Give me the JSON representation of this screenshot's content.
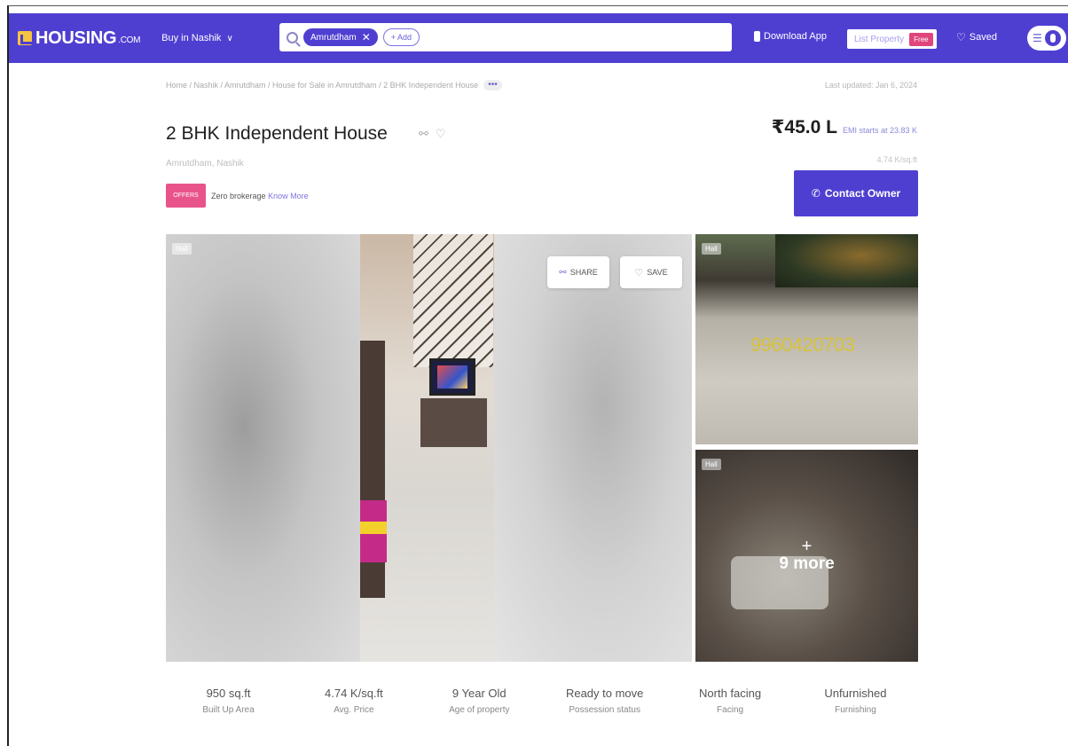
{
  "header": {
    "logo_text": "HOUSING",
    "logo_suffix": ".COM",
    "city_label": "Buy in Nashik",
    "search_chip": "Amrutdham",
    "add_label": "+ Add",
    "download_app": "Download App",
    "list_property": "List Property",
    "free_badge": "Free",
    "saved": "Saved",
    "brand_color": "#4f3fd1"
  },
  "breadcrumb": {
    "path": "Home / Nashik / Amrutdham / House for Sale in Amrutdham / 2 BHK Independent House",
    "more": "•••"
  },
  "last_updated": "Last updated: Jan 6, 2024",
  "listing": {
    "title": "2 BHK Independent House",
    "location": "Amrutdham, Nashik",
    "offers_badge": "OFFERS",
    "offers_text": "Zero brokerage",
    "offers_link": "Know More",
    "price": "₹45.0 L",
    "emi": "EMI starts at 23.83 K",
    "price_per_sqft": "4.74 K/sq.ft",
    "contact_label": "Contact Owner"
  },
  "gallery": {
    "main_tag": "Hall",
    "share_label": "SHARE",
    "save_label": "SAVE",
    "side_top_tag": "Hall",
    "watermark": "9960420703",
    "side_bottom_tag": "Hall",
    "more_plus": "+",
    "more_label": "9 more"
  },
  "stats": [
    {
      "value": "950 sq.ft",
      "label": "Built Up Area"
    },
    {
      "value": "4.74 K/sq.ft",
      "label": "Avg. Price"
    },
    {
      "value": "9 Year Old",
      "label": "Age of property"
    },
    {
      "value": "Ready to move",
      "label": "Possession status"
    },
    {
      "value": "North facing",
      "label": "Facing"
    },
    {
      "value": "Unfurnished",
      "label": "Furnishing"
    }
  ]
}
